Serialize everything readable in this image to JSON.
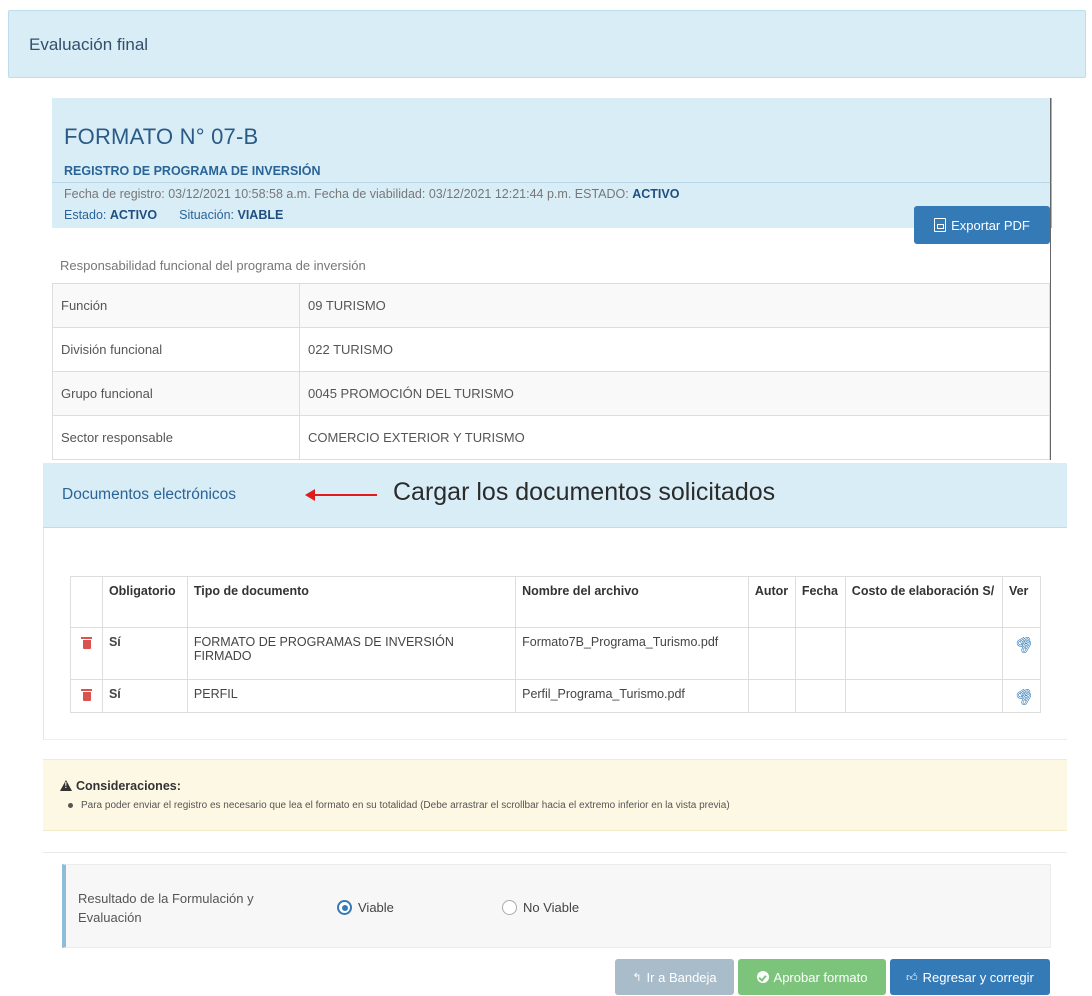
{
  "header": {
    "title": "Evaluación final"
  },
  "formato": {
    "title": "FORMATO N° 07-B",
    "subtitle": "REGISTRO DE PROGRAMA DE INVERSIÓN",
    "meta_prefix": "Fecha de registro: 03/12/2021 10:58:58 a.m. Fecha de viabilidad: 03/12/2021 12:21:44 p.m. ESTADO: ",
    "meta_estado": "ACTIVO",
    "estado_label": "Estado: ",
    "estado_value": "ACTIVO",
    "situacion_label": "Situación: ",
    "situacion_value": "VIABLE",
    "export_label": "Exportar PDF"
  },
  "responsabilidad": {
    "label": "Responsabilidad funcional del programa de inversión",
    "rows": [
      {
        "key": "Función",
        "value": "09 TURISMO"
      },
      {
        "key": "División funcional",
        "value": "022 TURISMO"
      },
      {
        "key": "Grupo funcional",
        "value": "0045 PROMOCIÓN DEL TURISMO"
      },
      {
        "key": "Sector responsable",
        "value": "COMERCIO EXTERIOR Y TURISMO"
      }
    ]
  },
  "documentos": {
    "title": "Documentos electrónicos",
    "annotation": "Cargar los documentos solicitados",
    "columns": [
      "Obligatorio",
      "Tipo de documento",
      "Nombre del archivo",
      "Autor",
      "Fecha",
      "Costo de elaboración S/",
      "Ver"
    ],
    "rows": [
      {
        "obligatorio": "Sí",
        "tipo": "FORMATO DE PROGRAMAS DE INVERSIÓN FIRMADO",
        "archivo": "Formato7B_Programa_Turismo.pdf",
        "autor": "",
        "fecha": "",
        "costo": ""
      },
      {
        "obligatorio": "Sí",
        "tipo": "PERFIL",
        "archivo": "Perfil_Programa_Turismo.pdf",
        "autor": "",
        "fecha": "",
        "costo": ""
      }
    ]
  },
  "consideraciones": {
    "title": "Consideraciones:",
    "item": "Para poder enviar el registro es necesario que lea el formato en su totalidad (Debe arrastrar el scrollbar hacia el extremo inferior en la vista previa)"
  },
  "resultado": {
    "label": "Resultado de la Formulación y Evaluación",
    "options": [
      {
        "label": "Viable",
        "selected": true
      },
      {
        "label": "No Viable",
        "selected": false
      }
    ]
  },
  "actions": {
    "bandeja": "Ir a Bandeja",
    "aprobar": "Aprobar formato",
    "regresar": "Regresar y corregir"
  },
  "colors": {
    "primary": "#337ab7",
    "success": "#7cc47c",
    "info_bg": "#d9edf7",
    "warning_bg": "#fcf8e3",
    "danger": "#d9534f"
  }
}
